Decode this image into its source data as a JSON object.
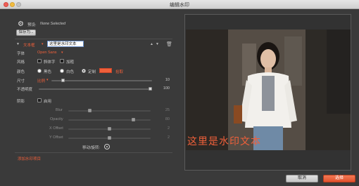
{
  "window": {
    "title": "编辑水印"
  },
  "preset": {
    "label": "预设:",
    "value": "None Selected",
    "save_button": "保存为..."
  },
  "text_layer": {
    "label": "文本框",
    "value": "这里是水印文本"
  },
  "font": {
    "label": "字体",
    "value": "Open Sans"
  },
  "style": {
    "label": "风格",
    "italic_label": "斜体字",
    "bold_label": "加粗"
  },
  "color": {
    "label": "颜色",
    "black_label": "黑色",
    "white_label": "白色",
    "custom_label": "定制",
    "selected": "定制",
    "custom_hex": "#f0603a",
    "link_label": "拾取"
  },
  "size": {
    "label": "尺寸",
    "mode": "比例",
    "value": "10",
    "level": 0.1
  },
  "opacity": {
    "label": "不透明度",
    "value": "100",
    "level": 1.0
  },
  "shadow": {
    "label": "阴影",
    "enable_label": "启用",
    "blur": {
      "label": "Blur",
      "value": "25",
      "level": 0.25
    },
    "opacity": {
      "label": "Opacity",
      "value": "80",
      "level": 0.8
    },
    "x_offset": {
      "label": "X Offset",
      "value": "2",
      "level": 0.5
    },
    "y_offset": {
      "label": "Y Offset",
      "value": "2",
      "level": 0.5
    }
  },
  "move_rotate": {
    "label": "移动/旋转:"
  },
  "add_watermark": {
    "label": "添加水印项目"
  },
  "preview": {
    "watermark_text": "这里是水印文本"
  },
  "footer": {
    "cancel": "取消",
    "ok": "选择"
  }
}
